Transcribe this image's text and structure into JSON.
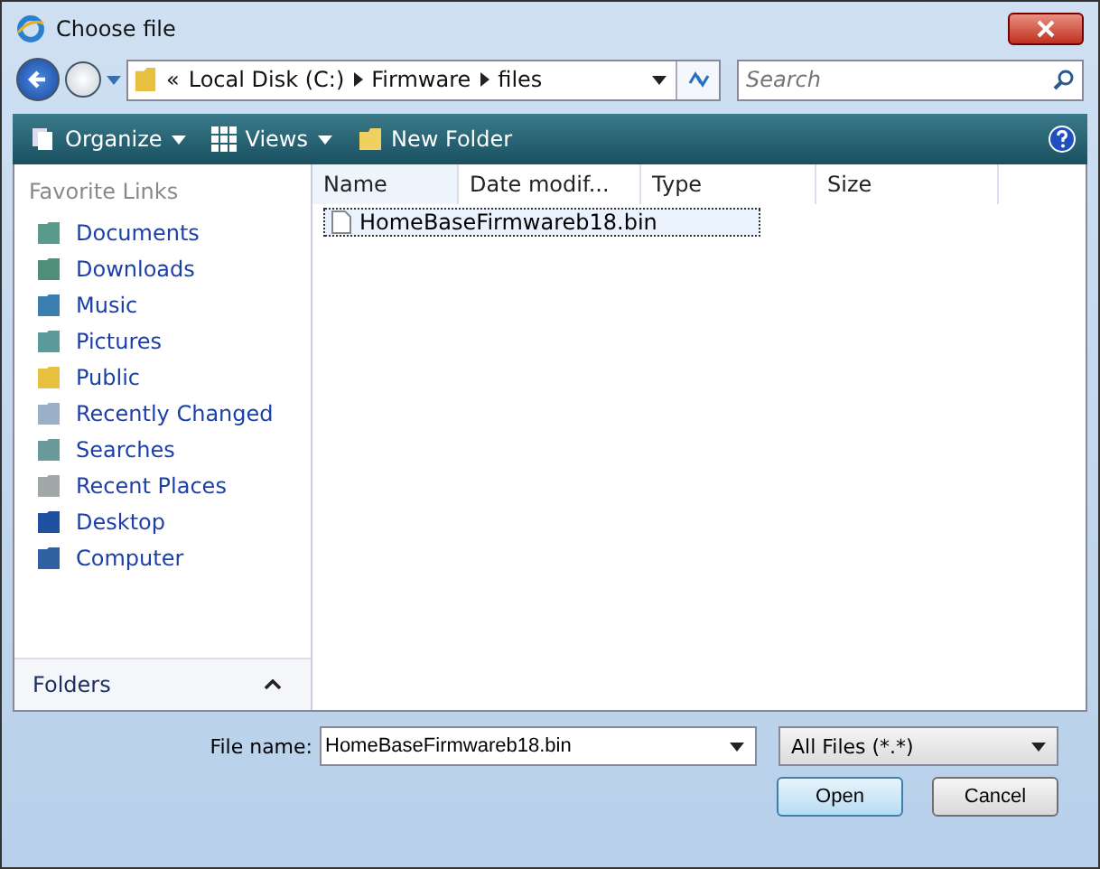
{
  "window": {
    "title": "Choose file"
  },
  "address": {
    "crumbs": [
      "«",
      "Local Disk (C:)",
      "Firmware",
      "files"
    ]
  },
  "search": {
    "placeholder": "Search"
  },
  "toolbar": [
    {
      "label": "Organize"
    },
    {
      "label": "Views"
    },
    {
      "label": "New Folder"
    }
  ],
  "sidebar": {
    "heading": "Favorite Links",
    "items": [
      {
        "label": "Documents"
      },
      {
        "label": "Downloads"
      },
      {
        "label": "Music"
      },
      {
        "label": "Pictures"
      },
      {
        "label": "Public"
      },
      {
        "label": "Recently Changed"
      },
      {
        "label": "Searches"
      },
      {
        "label": "Recent Places"
      },
      {
        "label": "Desktop"
      },
      {
        "label": "Computer"
      }
    ],
    "folders": "Folders"
  },
  "table": {
    "columns": [
      "Name",
      "Date modif...",
      "Type",
      "Size"
    ],
    "rows": [
      {
        "name": "HomeBaseFirmwareb18.bin",
        "selected": true
      }
    ]
  },
  "footer": {
    "file_name_label": "File name:",
    "file_name": "HomeBaseFirmwareb18.bin",
    "filter": "All Files (*.*)",
    "buttons": [
      "Open",
      "Cancel"
    ]
  }
}
